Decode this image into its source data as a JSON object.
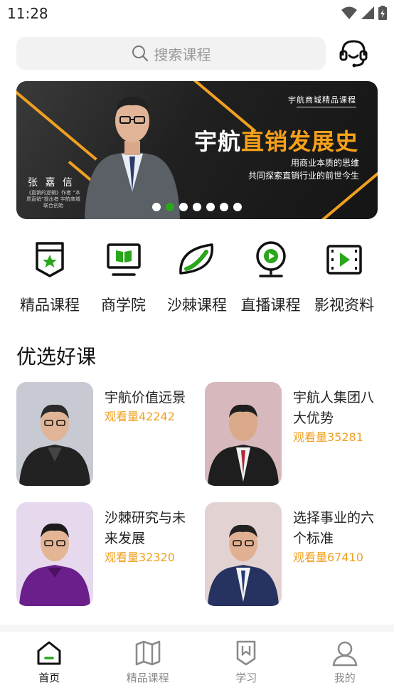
{
  "status": {
    "time": "11:28"
  },
  "search": {
    "placeholder": "搜索课程"
  },
  "banner": {
    "tag": "宇航商城精品课程",
    "title_a": "宇航",
    "title_b": "直销发展史",
    "line1": "用商业本质的思维",
    "line2": "共同探索直销行业的前世今生",
    "speaker": "张 嘉 信",
    "speaker_note": "《直销的逻辑》作者 “本质直销”提出者 宇航商城联合创始",
    "dot_count": 7,
    "active_dot": 1
  },
  "categories": [
    {
      "label": "精品课程",
      "icon": "badge-star-icon"
    },
    {
      "label": "商学院",
      "icon": "monitor-book-icon"
    },
    {
      "label": "沙棘课程",
      "icon": "leaf-icon"
    },
    {
      "label": "直播课程",
      "icon": "webcam-play-icon"
    },
    {
      "label": "影视资料",
      "icon": "film-play-icon"
    }
  ],
  "section": {
    "title": "优选好课"
  },
  "courses": [
    {
      "title": "宇航价值远景",
      "views": "观看量42242"
    },
    {
      "title": "宇航人集团八大优势",
      "views": "观看量35281"
    },
    {
      "title": "沙棘研究与未来发展",
      "views": "观看量32320"
    },
    {
      "title": "选择事业的六个标准",
      "views": "观看量67410"
    }
  ],
  "tabs": [
    {
      "label": "首页",
      "icon": "home-icon",
      "active": true
    },
    {
      "label": "精品课程",
      "icon": "book-icon",
      "active": false
    },
    {
      "label": "学习",
      "icon": "study-badge-icon",
      "active": false
    },
    {
      "label": "我的",
      "icon": "user-icon",
      "active": false
    }
  ],
  "colors": {
    "accent": "#2aa61c",
    "views": "#f0a020",
    "banner_highlight": "#f7a11a"
  }
}
